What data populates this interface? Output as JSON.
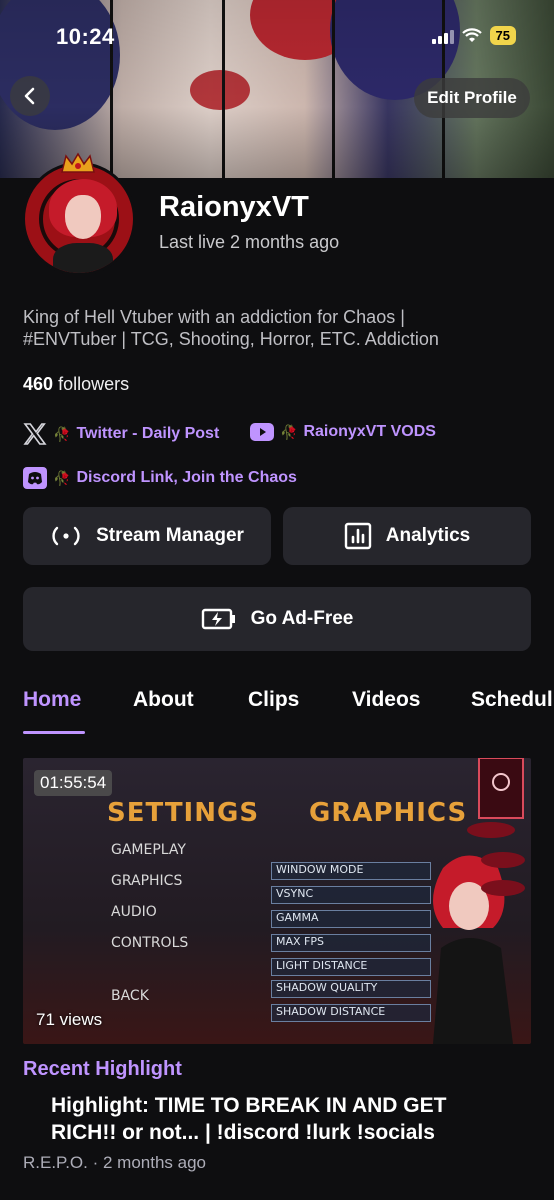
{
  "status_bar": {
    "time": "10:24",
    "battery": "75"
  },
  "header": {
    "edit_profile_label": "Edit Profile"
  },
  "profile": {
    "channel_name": "RaionyxVT",
    "last_live": "Last live 2 months ago",
    "bio": "King of Hell Vtuber with an addiction for Chaos | #ENVTuber | TCG, Shooting, Horror, ETC. Addiction",
    "followers_count": "460",
    "followers_label": "followers"
  },
  "social_links": [
    {
      "icon": "x-icon",
      "emoji": "🥀",
      "label": "Twitter - Daily Post"
    },
    {
      "icon": "youtube-icon",
      "emoji": "🥀",
      "label": "RaionyxVT VODS"
    },
    {
      "icon": "discord-icon",
      "emoji": "🥀",
      "label": "Discord Link, Join the Chaos"
    }
  ],
  "actions": {
    "stream_manager": "Stream Manager",
    "analytics": "Analytics",
    "ad_free": "Go Ad-Free"
  },
  "tabs": [
    {
      "label": "Home",
      "active": true
    },
    {
      "label": "About"
    },
    {
      "label": "Clips"
    },
    {
      "label": "Videos"
    },
    {
      "label": "Schedul"
    }
  ],
  "featured_video": {
    "duration": "01:55:54",
    "views": "71 views",
    "section_label": "Recent Highlight",
    "title": "Highlight: TIME TO BREAK IN AND GET RICH!! or not... | !discord !lurk !socials",
    "category": "R.E.P.O.",
    "age": "2 months ago",
    "thumb_text": {
      "settings": "SETTINGS",
      "graphics": "GRAPHICS",
      "menu": [
        "GAMEPLAY",
        "GRAPHICS",
        "AUDIO",
        "CONTROLS",
        "BACK"
      ],
      "options": [
        "WINDOW MODE",
        "VSYNC",
        "GAMMA",
        "MAX FPS",
        "LIGHT DISTANCE",
        "SHADOW QUALITY",
        "SHADOW DISTANCE"
      ]
    }
  },
  "colors": {
    "accent": "#bf94ff",
    "background": "#0e0e10",
    "button": "#26262c"
  }
}
